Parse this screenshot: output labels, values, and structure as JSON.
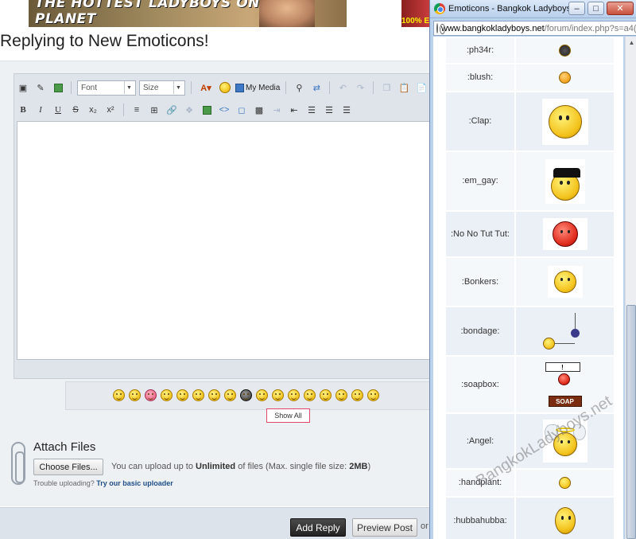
{
  "banner": {
    "left_text": "THE HOTTEST LADYBOYS ON THE PLANET",
    "right_text": "100% E"
  },
  "page": {
    "title": "Replying to New Emoticons!"
  },
  "editor": {
    "toolbar_row1": {
      "font_select": "Font",
      "size_select": "Size",
      "my_media": "My Media"
    },
    "toolbar_row2": {
      "bold": "B",
      "italic": "I",
      "underline": "U",
      "strike": "S",
      "subscript": "x₂",
      "superscript": "x²"
    },
    "smilies_count": 17,
    "show_all": "Show All"
  },
  "attachments": {
    "title": "Attach Files",
    "choose_button": "Choose Files...",
    "info_prefix": "You can upload up to ",
    "info_unlimited": "Unlimited",
    "info_middle": " of files (Max. single file size: ",
    "info_size": "2MB",
    "info_suffix": ")",
    "trouble_text": "Trouble uploading? ",
    "trouble_link": "Try our basic uploader"
  },
  "actions": {
    "add_reply": "Add Reply",
    "preview_post": "Preview Post",
    "or_text": "or"
  },
  "popup": {
    "title": "Emoticons - Bangkok Ladyboys ...",
    "minimize": "–",
    "maximize": "□",
    "close": "✕",
    "url_host": "www.bangkokladyboys.net",
    "url_path": "/forum/index.php?s=a4(",
    "emoticons": [
      {
        "code": ":ph34r:"
      },
      {
        "code": ":blush:"
      },
      {
        "code": ":Clap:"
      },
      {
        "code": ":em_gay:"
      },
      {
        "code": ":No No Tut Tut:"
      },
      {
        "code": ":Bonkers:"
      },
      {
        "code": ":bondage:"
      },
      {
        "code": ":soapbox:"
      },
      {
        "code": ":Angel:"
      },
      {
        "code": ":handplant:"
      },
      {
        "code": ":hubbahubba:"
      }
    ],
    "soapbox_sign": "!",
    "soapbox_box": "SOAP"
  },
  "watermark": "BangkokLadyboys.net",
  "colors": {
    "show_all_border": "#e04a6a",
    "link": "#1f4f88",
    "popup_frame": "#bcd3ee"
  }
}
